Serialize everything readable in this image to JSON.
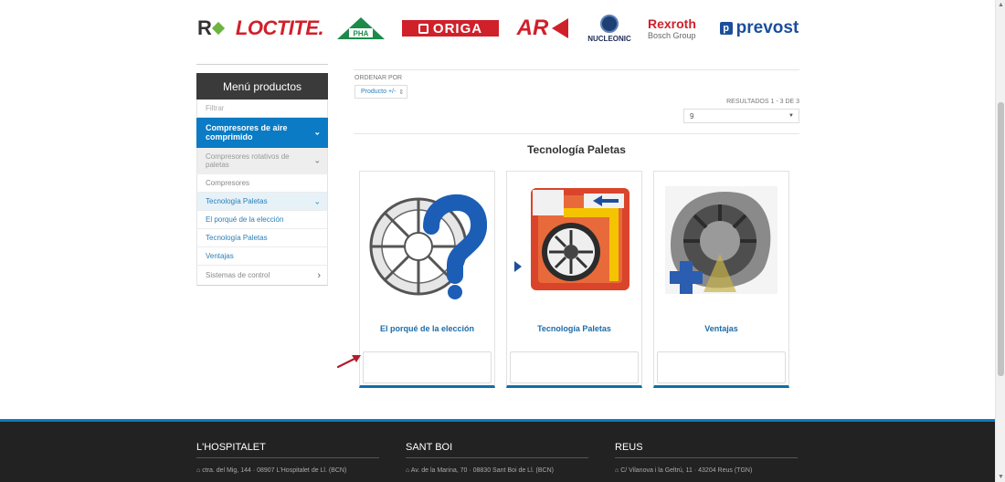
{
  "brands": {
    "partial": "R",
    "loctite": "LOCTITE.",
    "pha": "PHA",
    "origa": "ORIGA",
    "ar": "AR",
    "nucleonic": "NUCLEONIC",
    "rexroth_1": "Rexroth",
    "rexroth_2": "Bosch Group",
    "prevost": "prevost",
    "prevost_mark": "p"
  },
  "sidebar": {
    "title": "Menú productos",
    "filter_placeholder": "Filtrar",
    "items": [
      {
        "label": "Compresores de aire comprimido",
        "icon": "chevron-down-icon"
      },
      {
        "label": "Compresores rotativos de paletas",
        "icon": "chevron-down-icon"
      },
      {
        "label": "Compresores"
      },
      {
        "label": "Tecnología Paletas",
        "icon": "chevron-down-icon"
      },
      {
        "label": "El porqué de la elección"
      },
      {
        "label": "Tecnología Paletas"
      },
      {
        "label": "Ventajas"
      },
      {
        "label": "Sistemas de control",
        "icon": "chevron-right-icon"
      }
    ]
  },
  "main": {
    "order_label": "ORDENAR POR",
    "order_value": "Producto +/-",
    "results": "RESULTADOS 1 - 3 DE 3",
    "per_page": "9",
    "category_title": "Tecnología Paletas",
    "products": [
      {
        "name": "El porqué de la elección"
      },
      {
        "name": "Tecnología Paletas"
      },
      {
        "name": "Ventajas"
      }
    ]
  },
  "footer": {
    "columns": [
      {
        "title": "L'HOSPITALET",
        "address": "ctra. del Mig, 144 · 08907 L'Hospitalet de Ll. (BCN)"
      },
      {
        "title": "SANT BOI",
        "address": "Av. de la Marina, 70 · 08830 Sant Boi de Ll. (BCN)"
      },
      {
        "title": "REUS",
        "address": "C/ Vilanova i la Geltrú, 11 · 43204 Reus (TGN)"
      }
    ]
  },
  "colors": {
    "accent": "#0a7bc4",
    "link": "#1d6ca8",
    "footer_bg": "#222222",
    "sidebar_head": "#3a3a3a"
  }
}
